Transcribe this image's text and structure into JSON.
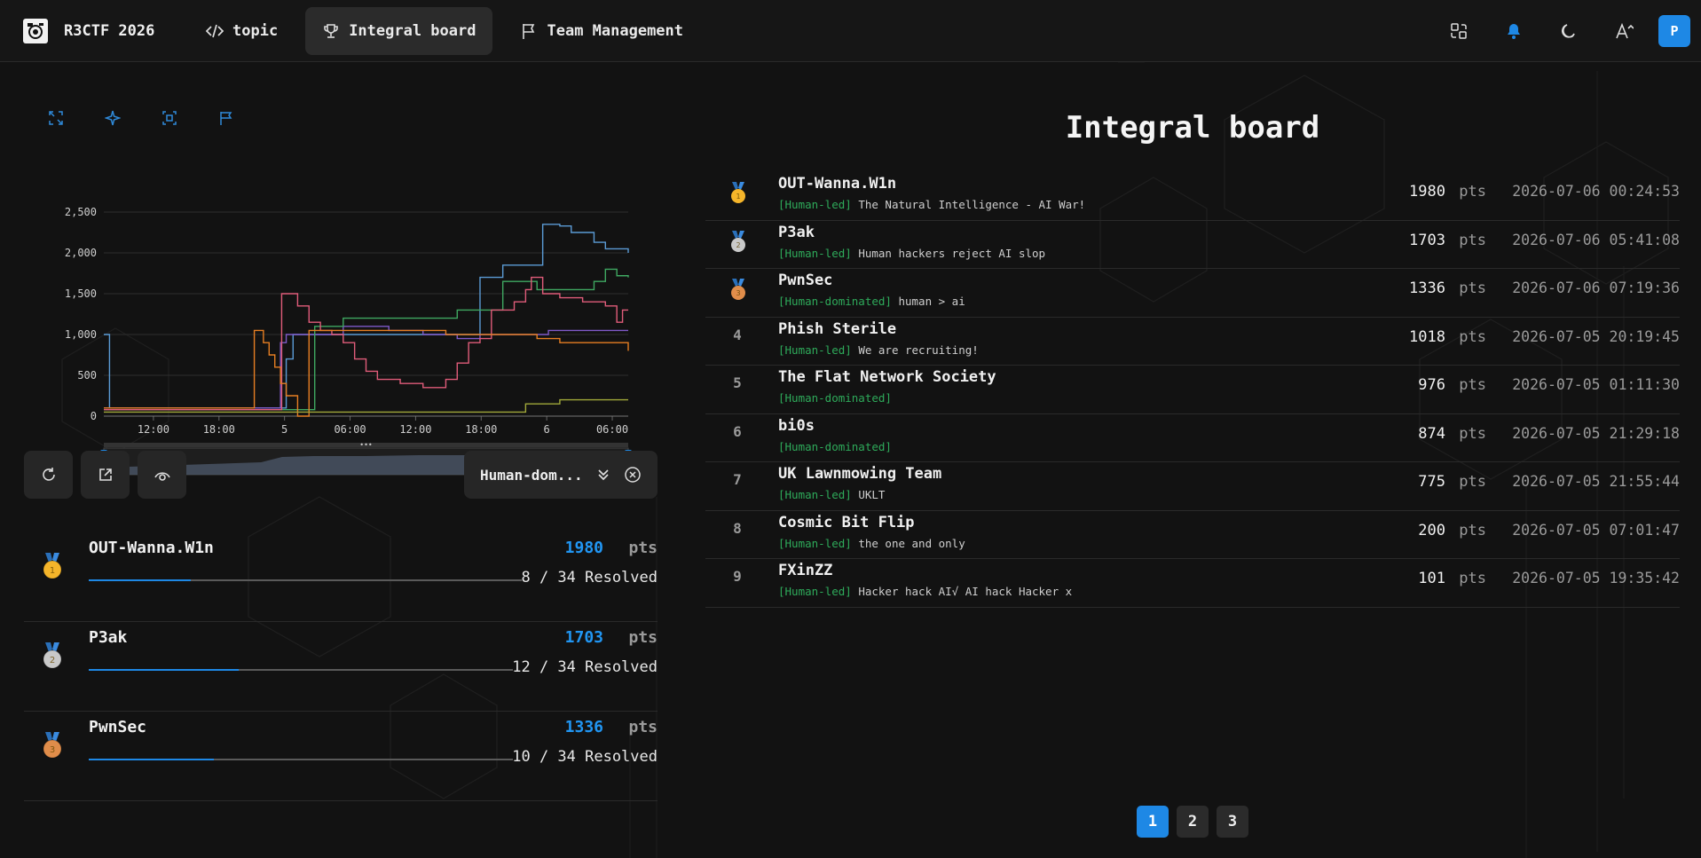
{
  "nav": {
    "brand": "R3CTF 2026",
    "items": [
      {
        "label": "topic",
        "icon": "code-icon"
      },
      {
        "label": "Integral board",
        "icon": "trophy-icon",
        "active": true
      },
      {
        "label": "Team Management",
        "icon": "flag-icon"
      }
    ],
    "right_icons": [
      "translate-icon",
      "notification-bell-icon",
      "moon-icon",
      "font-size-icon"
    ],
    "avatar": "P"
  },
  "chart_toolbar": [
    "zoom-icon",
    "plane-icon",
    "select-area-icon",
    "flag-icon"
  ],
  "chart_data": {
    "type": "line",
    "title": "",
    "ylim": [
      0,
      2500
    ],
    "yticks": [
      "0",
      "500",
      "1,000",
      "1,500",
      "2,000",
      "2,500"
    ],
    "xticks": [
      "12:00",
      "18:00",
      "5",
      "06:00",
      "12:00",
      "18:00",
      "6",
      "06:00"
    ],
    "x_unit": "hours since start",
    "grid": true,
    "series": [
      {
        "color": "#5b9bd5",
        "points": [
          [
            0,
            1000
          ],
          [
            0.5,
            100
          ],
          [
            8,
            100
          ],
          [
            15.5,
            100
          ],
          [
            16,
            700
          ],
          [
            16.6,
            1000
          ],
          [
            31,
            1000
          ],
          [
            32.7,
            1000
          ],
          [
            33,
            1700
          ],
          [
            34.6,
            1700
          ],
          [
            35,
            1850
          ],
          [
            38,
            1850
          ],
          [
            38.5,
            2350
          ],
          [
            40,
            2330
          ],
          [
            41,
            2250
          ],
          [
            43,
            2130
          ],
          [
            44,
            2050
          ],
          [
            46,
            2000
          ]
        ]
      },
      {
        "color": "#7f5ac8",
        "points": [
          [
            0,
            100
          ],
          [
            15,
            100
          ],
          [
            15.5,
            900
          ],
          [
            16,
            1000
          ],
          [
            20,
            1000
          ],
          [
            21,
            1100
          ],
          [
            25,
            1050
          ],
          [
            27,
            1050
          ],
          [
            28,
            1000
          ],
          [
            31,
            950
          ],
          [
            33,
            1000
          ],
          [
            38.5,
            1000
          ],
          [
            39,
            1050
          ],
          [
            46,
            1050
          ]
        ]
      },
      {
        "color": "#3fa861",
        "points": [
          [
            0,
            80
          ],
          [
            18,
            80
          ],
          [
            18.5,
            1100
          ],
          [
            20,
            1100
          ],
          [
            21,
            1200
          ],
          [
            31,
            1300
          ],
          [
            34,
            1300
          ],
          [
            35,
            1650
          ],
          [
            38,
            1550
          ],
          [
            42,
            1550
          ],
          [
            43,
            1650
          ],
          [
            44,
            1800
          ],
          [
            45,
            1720
          ],
          [
            46,
            1700
          ]
        ]
      },
      {
        "color": "#e05c7a",
        "points": [
          [
            0,
            80
          ],
          [
            15.4,
            80
          ],
          [
            15.6,
            1500
          ],
          [
            17,
            1350
          ],
          [
            18,
            1150
          ],
          [
            19,
            1050
          ],
          [
            20,
            1000
          ],
          [
            21,
            900
          ],
          [
            22,
            700
          ],
          [
            23,
            550
          ],
          [
            24,
            450
          ],
          [
            26,
            400
          ],
          [
            28,
            350
          ],
          [
            29,
            350
          ],
          [
            30,
            450
          ],
          [
            31,
            650
          ],
          [
            32,
            900
          ],
          [
            33,
            950
          ],
          [
            34,
            1300
          ],
          [
            36,
            1400
          ],
          [
            37,
            1550
          ],
          [
            37.5,
            1700
          ],
          [
            38.5,
            1500
          ],
          [
            40,
            1450
          ],
          [
            42,
            1400
          ],
          [
            44,
            1350
          ],
          [
            45,
            1150
          ],
          [
            45.5,
            1300
          ],
          [
            46,
            1300
          ]
        ]
      },
      {
        "color": "#e67e22",
        "points": [
          [
            0,
            100
          ],
          [
            13,
            100
          ],
          [
            13.2,
            1050
          ],
          [
            14,
            900
          ],
          [
            14.5,
            750
          ],
          [
            15,
            600
          ],
          [
            15.5,
            400
          ],
          [
            16,
            250
          ],
          [
            17,
            0
          ],
          [
            17.5,
            0
          ],
          [
            18,
            1050
          ],
          [
            26,
            1050
          ],
          [
            30,
            1000
          ],
          [
            38,
            950
          ],
          [
            40,
            900
          ],
          [
            44,
            900
          ],
          [
            46,
            800
          ]
        ]
      },
      {
        "color": "#a0a83a",
        "points": [
          [
            0,
            50
          ],
          [
            36,
            50
          ],
          [
            37,
            150
          ],
          [
            40,
            200
          ],
          [
            46,
            200
          ]
        ]
      }
    ]
  },
  "controls": {
    "buttons": [
      "refresh-icon",
      "export-icon",
      "visibility-icon"
    ],
    "filter_value": "Human-dom..."
  },
  "top_teams": [
    {
      "rank": 1,
      "name": "OUT-Wanna.W1n",
      "score": "1980",
      "pts": "pts",
      "solved": 8,
      "resolved": "8 / 34 Resolved"
    },
    {
      "rank": 2,
      "name": "P3ak",
      "score": "1703",
      "pts": "pts",
      "solved": 12,
      "resolved": "12 / 34 Resolved"
    },
    {
      "rank": 3,
      "name": "PwnSec",
      "score": "1336",
      "pts": "pts",
      "solved": 10,
      "resolved": "10 / 34 Resolved"
    }
  ],
  "board": {
    "title": "Integral board",
    "rows": [
      {
        "rank": "1",
        "name": "OUT-Wanna.W1n",
        "tag": "[Human-led]",
        "motto": "The Natural Intelligence - AI War!",
        "score": "1980",
        "pts": "pts",
        "time": "2026-07-06 00:24:53"
      },
      {
        "rank": "2",
        "name": "P3ak",
        "tag": "[Human-led]",
        "motto": "Human hackers reject AI slop",
        "score": "1703",
        "pts": "pts",
        "time": "2026-07-06 05:41:08"
      },
      {
        "rank": "3",
        "name": "PwnSec",
        "tag": "[Human-dominated]",
        "motto": "human > ai",
        "score": "1336",
        "pts": "pts",
        "time": "2026-07-06 07:19:36"
      },
      {
        "rank": "4",
        "name": "Phish Sterile",
        "tag": "[Human-led]",
        "motto": "We are recruiting!",
        "score": "1018",
        "pts": "pts",
        "time": "2026-07-05 20:19:45"
      },
      {
        "rank": "5",
        "name": "The Flat Network Society",
        "tag": "[Human-dominated]",
        "motto": "",
        "score": "976",
        "pts": "pts",
        "time": "2026-07-05 01:11:30"
      },
      {
        "rank": "6",
        "name": "bi0s",
        "tag": "[Human-dominated]",
        "motto": "",
        "score": "874",
        "pts": "pts",
        "time": "2026-07-05 21:29:18"
      },
      {
        "rank": "7",
        "name": "UK Lawnmowing Team",
        "tag": "[Human-led]",
        "motto": "UKLT",
        "score": "775",
        "pts": "pts",
        "time": "2026-07-05 21:55:44"
      },
      {
        "rank": "8",
        "name": "Cosmic Bit Flip",
        "tag": "[Human-led]",
        "motto": "the one and only",
        "score": "200",
        "pts": "pts",
        "time": "2026-07-05 07:01:47"
      },
      {
        "rank": "9",
        "name": "FXinZZ",
        "tag": "[Human-led]",
        "motto": "Hacker hack AI√ AI hack Hacker x",
        "score": "101",
        "pts": "pts",
        "time": "2026-07-05 19:35:42"
      }
    ],
    "pages": [
      "1",
      "2",
      "3"
    ],
    "current_page": "1"
  },
  "colors": {
    "accent": "#1e88e5",
    "gold": "#f5b52a",
    "silver": "#c9c9c9",
    "bronze": "#e08d4a",
    "tag_green": "#2eaa5a"
  }
}
